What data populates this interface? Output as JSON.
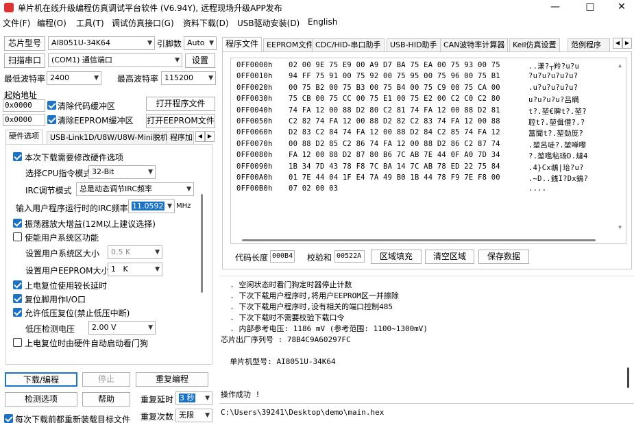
{
  "window": {
    "title": "单片机在线升级编程仿真调试平台软件 (V6.94Y), 远程现场升级APP发布"
  },
  "menu": [
    "文件(F)",
    "编程(O)",
    "工具(T)",
    "调试仿真接口(G)",
    "资料下载(D)",
    "USB驱动安装(D)",
    "English"
  ],
  "chip": {
    "label": "芯片型号",
    "value": "AI8051U-34K64",
    "pin_label": "引脚数",
    "pin_value": "Auto"
  },
  "serial": {
    "scan_button": "扫描串口",
    "port_value": "(COM1) 通信端口",
    "settings_button": "设置"
  },
  "baud": {
    "min_label": "最低波特率",
    "min_value": "2400",
    "max_label": "最高波特率",
    "max_value": "115200"
  },
  "address": {
    "label": "起始地址",
    "code_addr": "0x0000",
    "eeprom_addr": "0x0000",
    "clear_code": "清除代码缓冲区",
    "clear_eeprom": "清除EEPROM缓冲区",
    "open_prog": "打开程序文件",
    "open_eeprom": "打开EEPROM文件"
  },
  "left_tabs": [
    "硬件选项",
    "USB-Link1D/U8W/U8W-Mini脱机",
    "程序加"
  ],
  "hw_options": {
    "modify": "本次下载需要修改硬件选项",
    "cpu_label": "选择CPU指令模式",
    "cpu_value": "32-Bit",
    "irc_label": "IRC调节模式",
    "irc_value": "总是动态调节IRC频率",
    "freq_label": "输入用户程序运行时的IRC频率",
    "freq_value": "11.0592",
    "freq_unit": "MHz",
    "amp_gain": "振荡器放大增益(12M以上建议选择)",
    "enable_partition": "使能用户系统区功能",
    "sys_size_label": "设置用户系统区大小",
    "sys_size_value": "0.5 K",
    "eeprom_size_label": "设置用户EEPROM大小",
    "eeprom_size_value": "1   K",
    "power_reset_delay": "上电复位使用较长延时",
    "reset_pin_io": "复位脚用作I/O口",
    "low_volt_reset": "允许低压复位(禁止低压中断)",
    "low_volt_label": "低压检测电压",
    "low_volt_value": "2.00 V",
    "watchdog_auto": "上电复位时由硬件自动启动看门狗"
  },
  "bottom_buttons": {
    "download": "下载/编程",
    "stop": "停止",
    "reprogram": "重复编程",
    "check": "检测选项",
    "help": "帮助",
    "delay_label": "重复延时",
    "delay_value": "3 秒",
    "count_label": "重复次数",
    "count_value": "无限",
    "reload": "每次下载前都重新装载目标文件"
  },
  "right_tabs": [
    "程序文件",
    "EEPROM文件",
    "CDC/HID-串口助手",
    "USB-HID助手",
    "CAN波特率计算器",
    "Keil仿真设置",
    "范例程序"
  ],
  "hex": {
    "rows": [
      {
        "addr": "0FF0000h",
        "bytes": "02 00 9E 75 E9 00 A9 D7 BA 75 EA 00 75 93 00 75",
        "ascii": "..漾?┬羚?u?u"
      },
      {
        "addr": "0FF0010h",
        "bytes": "94 FF 75 91 00 75 92 00 75 95 00 75 96 00 75 B1",
        "ascii": "?u?u?u?u?u?"
      },
      {
        "addr": "0FF0020h",
        "bytes": "00 75 B2 00 75 B3 00 75 B4 00 75 C9 00 75 CA 00",
        "ascii": ".u?u?u?u?u?"
      },
      {
        "addr": "0FF0030h",
        "bytes": "75 CB 00 75 CC 00 75 E1 00 75 E2 00 C2 C0 C2 80",
        "ascii": "u?u?u?u?吕瞒"
      },
      {
        "addr": "0FF0040h",
        "bytes": "74 FA 12 00 88 D2 80 C2 81 74 FA 12 00 88 D2 81",
        "ascii": "t?.堃€聛t?.堃?"
      },
      {
        "addr": "0FF0050h",
        "bytes": "C2 82 74 FA 12 00 88 D2 82 C2 83 74 FA 12 00 88",
        "ascii": "聜t?.堃偮僼?.?"
      },
      {
        "addr": "0FF0060h",
        "bytes": "D2 83 C2 84 74 FA 12 00 88 D2 84 C2 85 74 FA 12",
        "ascii": "葍聞t?.堃勎厐?"
      },
      {
        "addr": "0FF0070h",
        "bytes": "00 88 D2 85 C2 86 74 FA 12 00 88 D2 86 C2 87 74",
        "ascii": ".堃呂唗?.堃啴嚟"
      },
      {
        "addr": "0FF0080h",
        "bytes": "FA 12 00 88 D2 87 80 B6 7C AB 7E 44 0F A0 7D 34",
        "ascii": "?.堃嚂秥玚D.燵4"
      },
      {
        "addr": "0FF0090h",
        "bytes": "1B 34 7D 43 78 F8 7C BA 14 7C AB 78 ED 22 75 84",
        "ascii": ".4}Cx鴢|珆?u?"
      },
      {
        "addr": "0FF00A0h",
        "bytes": "01 7E 44 04 1F E4 7A 49 B0 1B 44 78 F9 7E F8 00",
        "ascii": ".~D..銭I?Dx鵭?"
      },
      {
        "addr": "0FF00B0h",
        "bytes": "07 02 00 03",
        "ascii": "...."
      }
    ],
    "code_length_label": "代码长度",
    "code_length_value": "000B4",
    "checksum_label": "校验和",
    "checksum_value": "00522A",
    "fill_button": "区域填充",
    "clear_button": "清空区域",
    "save_button": "保存数据"
  },
  "log": {
    "lines": [
      "  . 空闲状态时看门狗定时器停止计数",
      "  . 下次下载用户程序时,将用户EEPROM区一并擦除",
      "  . 下次下载用户程序时,没有相关的端口控制485",
      "  . 下次下载时不需要校验下载口令",
      "  . 内部参考电压: 1186 mV (参考范围: 1100~1300mV)",
      "芯片出厂序列号 : 78B4C9A60297FC",
      "",
      "  单片机型号: AI8051U-34K64",
      "",
      "",
      "操作成功 !"
    ]
  },
  "file_path": "C:\\Users\\39241\\Desktop\\demo\\main.hex",
  "colors": {
    "accent": "#1a73c9",
    "selection": "#1a73c9"
  }
}
